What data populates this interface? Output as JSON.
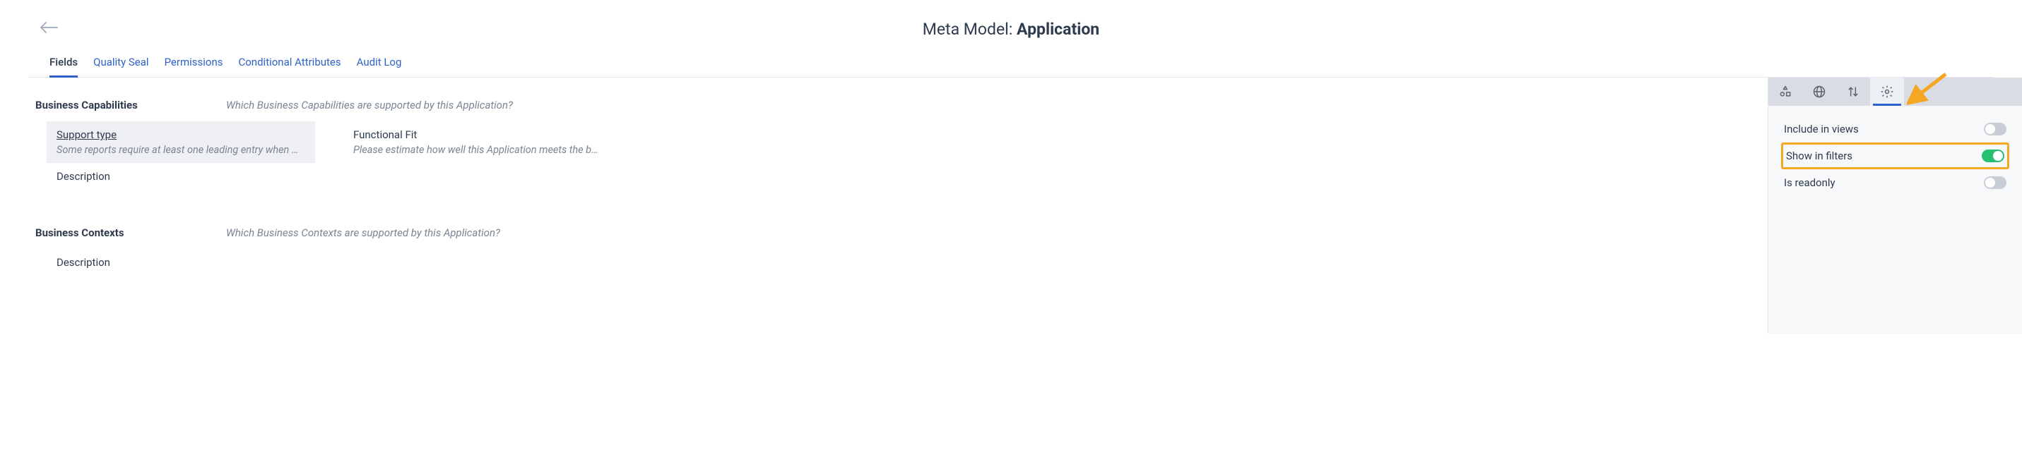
{
  "header": {
    "title_prefix": "Meta Model: ",
    "title_name": "Application"
  },
  "tabs": [
    {
      "label": "Fields",
      "active": true
    },
    {
      "label": "Quality Seal",
      "active": false
    },
    {
      "label": "Permissions",
      "active": false
    },
    {
      "label": "Conditional Attributes",
      "active": false
    },
    {
      "label": "Audit Log",
      "active": false
    }
  ],
  "sections": [
    {
      "title": "Business Capabilities",
      "desc": "Which Business Capabilities are supported by this Application?",
      "fields": [
        {
          "name": "Support type",
          "help": "Some reports require at least one leading entry when multiple Busines…",
          "selected": true
        },
        {
          "name": "Functional Fit",
          "help": "Please estimate how well this Application meets the business requirem…",
          "selected": false
        },
        {
          "name": "Description",
          "help": "",
          "selected": false
        }
      ]
    },
    {
      "title": "Business Contexts",
      "desc": "Which Business Contexts are supported by this Application?",
      "fields": [
        {
          "name": "Description",
          "help": "",
          "selected": false
        }
      ]
    }
  ],
  "side_tabs": [
    {
      "icon": "shapes",
      "active": false
    },
    {
      "icon": "globe",
      "active": false
    },
    {
      "icon": "sort",
      "active": false
    },
    {
      "icon": "gear",
      "active": true
    }
  ],
  "settings": [
    {
      "label": "Include in views",
      "on": false,
      "highlighted": false
    },
    {
      "label": "Show in filters",
      "on": true,
      "highlighted": true
    },
    {
      "label": "Is readonly",
      "on": false,
      "highlighted": false
    }
  ]
}
